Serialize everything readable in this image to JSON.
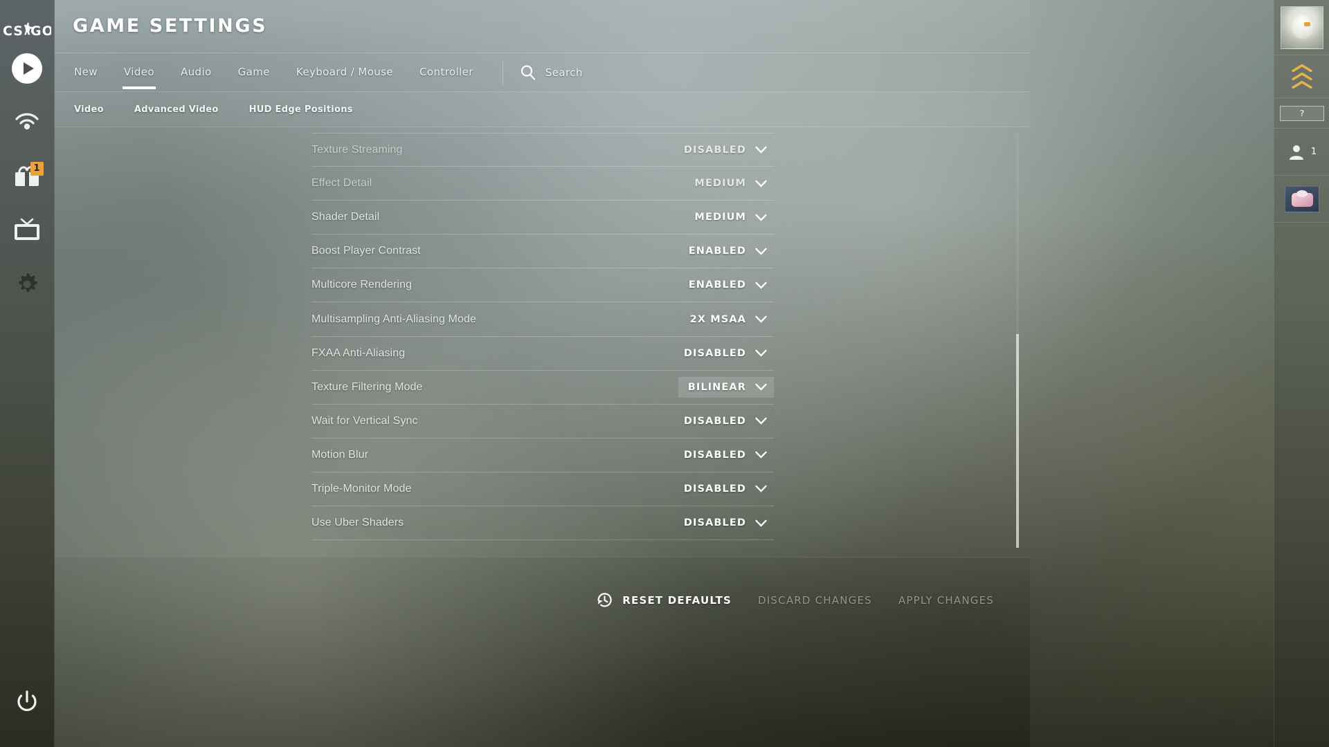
{
  "header": {
    "title": "GAME SETTINGS",
    "logo_text": "CS:GO"
  },
  "tabs": [
    {
      "label": "New",
      "active": false
    },
    {
      "label": "Video",
      "active": true
    },
    {
      "label": "Audio",
      "active": false
    },
    {
      "label": "Game",
      "active": false
    },
    {
      "label": "Keyboard / Mouse",
      "active": false
    },
    {
      "label": "Controller",
      "active": false
    }
  ],
  "search": {
    "label": "Search",
    "icon": "search-icon"
  },
  "subtabs": [
    {
      "label": "Video"
    },
    {
      "label": "Advanced Video"
    },
    {
      "label": "HUD Edge Positions"
    }
  ],
  "settings": [
    {
      "label": "Texture Streaming",
      "value": "DISABLED",
      "selected": false,
      "faded": true
    },
    {
      "label": "Effect Detail",
      "value": "MEDIUM",
      "selected": false,
      "faded": true
    },
    {
      "label": "Shader Detail",
      "value": "MEDIUM",
      "selected": false,
      "faded": false
    },
    {
      "label": "Boost Player Contrast",
      "value": "ENABLED",
      "selected": false,
      "faded": false
    },
    {
      "label": "Multicore Rendering",
      "value": "ENABLED",
      "selected": false,
      "faded": false
    },
    {
      "label": "Multisampling Anti-Aliasing Mode",
      "value": "2X MSAA",
      "selected": false,
      "faded": false
    },
    {
      "label": "FXAA Anti-Aliasing",
      "value": "DISABLED",
      "selected": false,
      "faded": false
    },
    {
      "label": "Texture Filtering Mode",
      "value": "BILINEAR",
      "selected": true,
      "faded": false
    },
    {
      "label": "Wait for Vertical Sync",
      "value": "DISABLED",
      "selected": false,
      "faded": false
    },
    {
      "label": "Motion Blur",
      "value": "DISABLED",
      "selected": false,
      "faded": false
    },
    {
      "label": "Triple-Monitor Mode",
      "value": "DISABLED",
      "selected": false,
      "faded": false
    },
    {
      "label": "Use Uber Shaders",
      "value": "DISABLED",
      "selected": false,
      "faded": false
    }
  ],
  "footer": {
    "reset_label": "RESET DEFAULTS",
    "discard_label": "DISCARD CHANGES",
    "apply_label": "APPLY CHANGES"
  },
  "rail": {
    "items": [
      {
        "name": "play-icon",
        "badge": null
      },
      {
        "name": "watch-icon",
        "badge": null
      },
      {
        "name": "inventory-icon",
        "badge": "1"
      },
      {
        "name": "tv-icon",
        "badge": null
      },
      {
        "name": "settings-icon",
        "badge": null
      },
      {
        "name": "power-icon",
        "badge": null
      }
    ]
  },
  "right_panel": {
    "help_label": "?",
    "friends_count": "1"
  },
  "colors": {
    "accent_badge": "#e8a33d",
    "text_primary": "#ffffff",
    "text_muted": "#a3a398",
    "selection": "rgba(255,255,255,0.14)"
  }
}
